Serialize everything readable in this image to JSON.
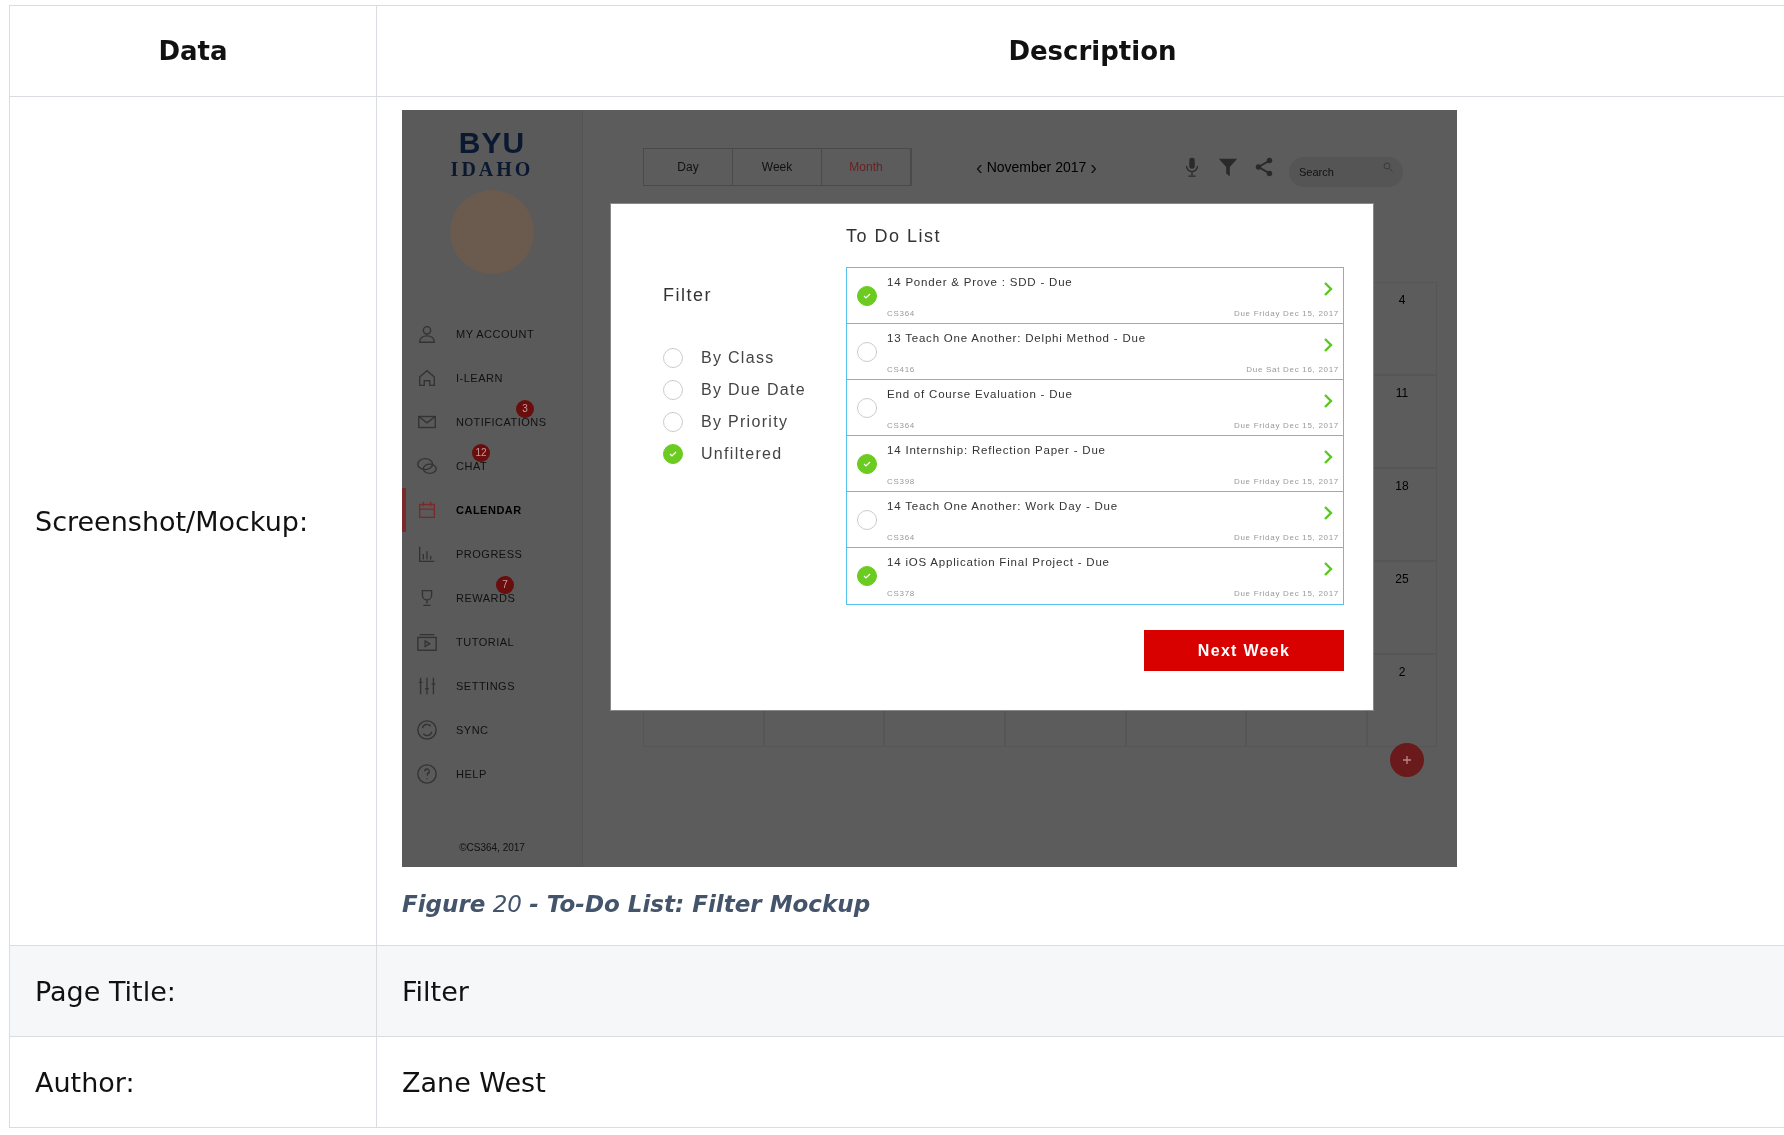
{
  "table": {
    "columns": [
      "Data",
      "Description"
    ],
    "rows": [
      {
        "kind": "mockup",
        "label": "Screenshot/Mockup:"
      },
      {
        "kind": "text",
        "label": "Page Title:",
        "value": "Filter"
      },
      {
        "kind": "text",
        "label": "Author:",
        "value": "Zane West"
      }
    ]
  },
  "mockup": {
    "logo": {
      "line1": "BYU",
      "line2": "IDAHO"
    },
    "nav": [
      {
        "label": "MY ACCOUNT",
        "selected": false
      },
      {
        "label": "I-LEARN",
        "selected": false
      },
      {
        "label": "NOTIFICATIONS",
        "selected": false,
        "badge": "3"
      },
      {
        "label": "CHAT",
        "selected": false,
        "badge": "12"
      },
      {
        "label": "CALENDAR",
        "selected": true
      },
      {
        "label": "PROGRESS",
        "selected": false
      },
      {
        "label": "REWARDS",
        "selected": false,
        "badge": "7"
      },
      {
        "label": "TUTORIAL",
        "selected": false
      },
      {
        "label": "SETTINGS",
        "selected": false
      },
      {
        "label": "SYNC",
        "selected": false
      },
      {
        "label": "HELP",
        "selected": false
      }
    ],
    "footer": "©CS364, 2017",
    "view_tabs": [
      {
        "label": "Day",
        "selected": false
      },
      {
        "label": "Week",
        "selected": false
      },
      {
        "label": "Month",
        "selected": true
      }
    ],
    "month": "November 2017",
    "prev": "‹",
    "next": "›",
    "search": {
      "placeholder": "Search"
    },
    "calendar_days": [
      "4",
      "11",
      "18",
      "25",
      "2"
    ],
    "modal": {
      "title": "To Do List",
      "filter_heading": "Filter",
      "filters": [
        {
          "label": "By Class",
          "selected": false
        },
        {
          "label": "By Due Date",
          "selected": false
        },
        {
          "label": "By Priority",
          "selected": false
        },
        {
          "label": "Unfiltered",
          "selected": true
        }
      ],
      "tasks": [
        {
          "title": "14 Ponder & Prove : SDD - Due",
          "course": "CS364",
          "due": "Due Friday Dec 15, 2017",
          "checked": true
        },
        {
          "title": "13 Teach One Another: Delphi Method - Due",
          "course": "CS416",
          "due": "Due Sat Dec 16, 2017",
          "checked": false
        },
        {
          "title": "End of Course Evaluation - Due",
          "course": "CS364",
          "due": "Due Friday Dec 15, 2017",
          "checked": false
        },
        {
          "title": "14 Internship: Reflection Paper - Due",
          "course": "CS398",
          "due": "Due Friday Dec 15, 2017",
          "checked": true
        },
        {
          "title": "14 Teach One Another: Work Day - Due",
          "course": "CS364",
          "due": "Due Friday Dec 15, 2017",
          "checked": false
        },
        {
          "title": "14 iOS Application Final Project - Due",
          "course": "CS378",
          "due": "Due Friday Dec 15, 2017",
          "checked": true
        }
      ],
      "button": "Next Week"
    }
  },
  "caption": "**Figure** 20 **- To-Do List: Filter Mockup**"
}
